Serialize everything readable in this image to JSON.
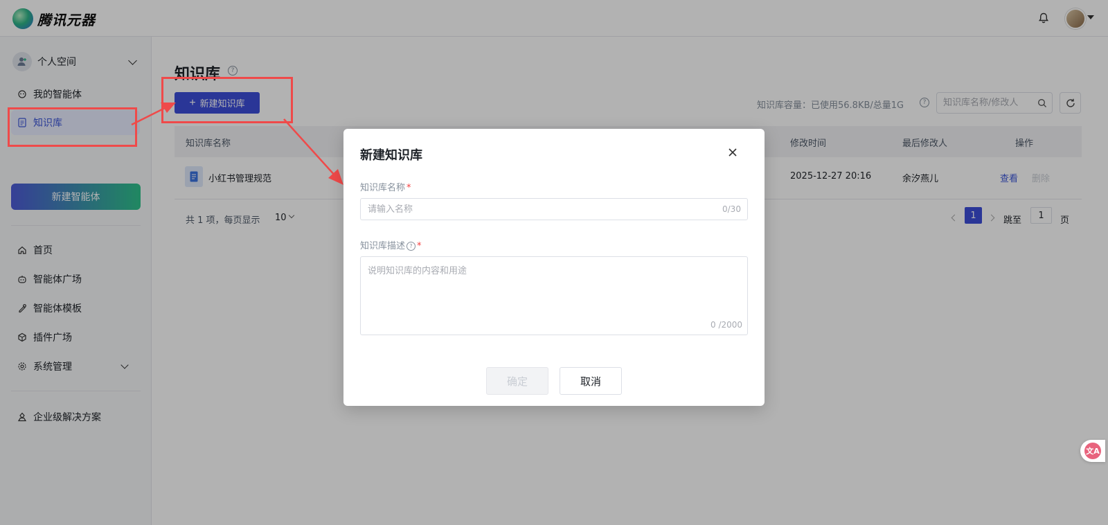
{
  "app": {
    "logo_text": "腾讯元器"
  },
  "sidebar": {
    "space_label": "个人空间",
    "items": [
      {
        "label": "我的智能体",
        "icon": "agent-icon"
      },
      {
        "label": "知识库",
        "icon": "doc-icon"
      },
      {
        "label": "首页",
        "icon": "home-icon"
      },
      {
        "label": "智能体广场",
        "icon": "robot-icon"
      },
      {
        "label": "智能体模板",
        "icon": "template-icon"
      },
      {
        "label": "插件广场",
        "icon": "cube-icon"
      },
      {
        "label": "系统管理",
        "icon": "gear-icon"
      },
      {
        "label": "企业级解决方案",
        "icon": "enterprise-icon"
      }
    ],
    "new_agent_label": "新建智能体"
  },
  "main": {
    "title": "知识库",
    "new_kb_label": "新建知识库",
    "capacity_text": "知识库容量：已使用56.8KB/总量1G",
    "search_placeholder": "知识库名称/修改人",
    "table": {
      "headers": [
        "知识库名称",
        "修改时间",
        "最后修改人",
        "操作"
      ],
      "rows": [
        {
          "name": "小红书管理规范",
          "time": "2025-12-27 20:16",
          "modifier": "余汐燕儿",
          "view": "查看",
          "delete": "删除"
        }
      ]
    },
    "pager": {
      "summary": "共 1 项，每页显示",
      "page_size": "10",
      "current": "1",
      "jump_label": "跳至",
      "jump_value": "1",
      "page_label": "页"
    }
  },
  "modal": {
    "title": "新建知识库",
    "name_label": "知识库名称",
    "name_placeholder": "请输入名称",
    "name_count": "0/30",
    "desc_label": "知识库描述",
    "desc_placeholder": "说明知识库的内容和用途",
    "desc_count": "0 /2000",
    "required_mark": "*",
    "ok_label": "确定",
    "cancel_label": "取消"
  },
  "colors": {
    "primary": "#3d4ed8",
    "annotation": "#ef4a4a",
    "required": "#f53f3f"
  }
}
